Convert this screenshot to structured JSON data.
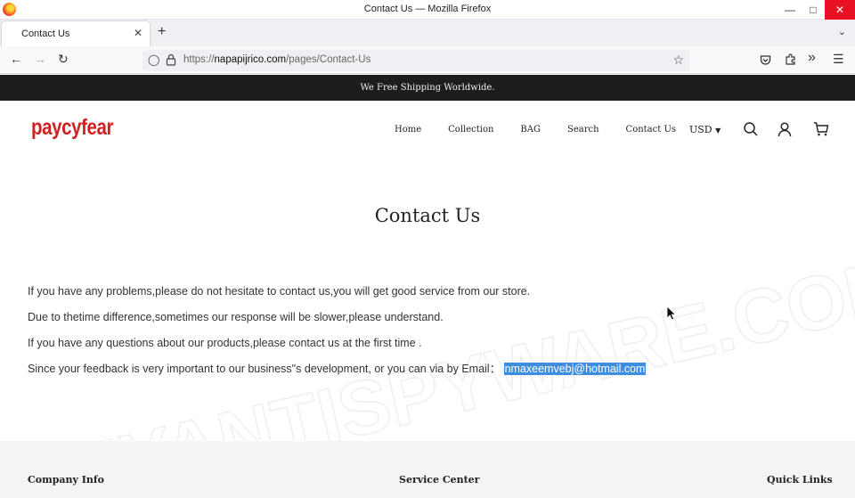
{
  "window": {
    "title": "Contact Us — Mozilla Firefox"
  },
  "tabs": [
    {
      "label": "Contact Us"
    }
  ],
  "url": {
    "prefix": "https://",
    "domain": "napapijrico.com",
    "path": "/pages/Contact-Us"
  },
  "announcement": "We Free Shipping Worldwide.",
  "store": {
    "logo": "paycyfear",
    "menu": [
      "Home",
      "Collection",
      "BAG",
      "Search",
      "Contact Us"
    ],
    "currency": "USD"
  },
  "content": {
    "title": "Contact Us",
    "lines": [
      "If you have any problems,please do not hesitate to contact us,you will get good service from our store.",
      "Due to thetime difference,sometimes our response will be slower,please understand.",
      "If you have any questions about our products,please contact us at the first time ."
    ],
    "email_line": "Since your feedback is very important to our business\"s development, or you can via by Email： ",
    "email": "nmaxeemvebj@hotmail.com"
  },
  "footer": {
    "headings": [
      "Company Info",
      "Service Center",
      "Quick Links"
    ]
  },
  "watermark": "MYANTISPYWARE.COM",
  "colors": {
    "brand": "#d21f21",
    "announce_bg": "#1d1d1f",
    "selection": "#3d8ee0"
  }
}
